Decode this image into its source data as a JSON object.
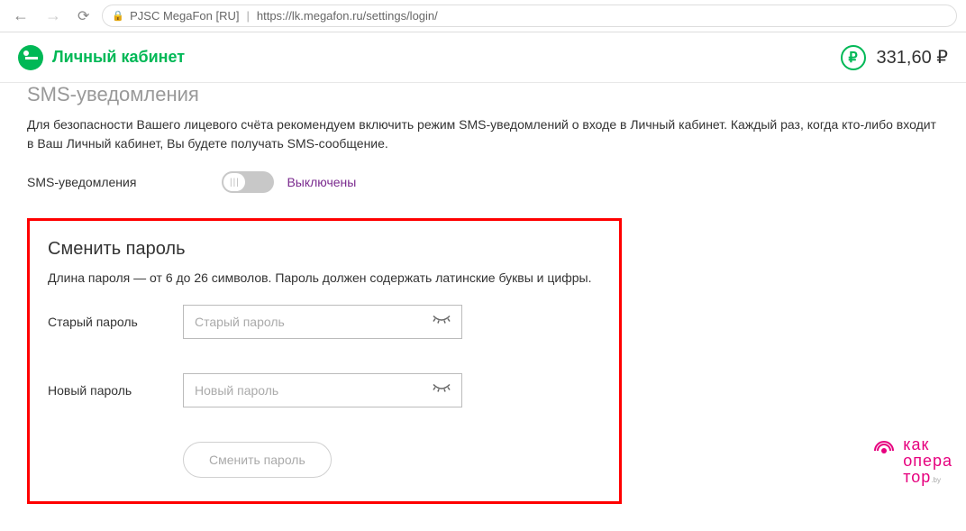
{
  "browser": {
    "site_identity": "PJSC MegaFon [RU]",
    "url": "https://lk.megafon.ru/settings/login/"
  },
  "header": {
    "brand": "Личный кабинет",
    "balance": "331,60 ₽",
    "currency_symbol": "₽"
  },
  "sms": {
    "title": "SMS-уведомления",
    "desc": "Для безопасности Вашего лицевого счёта рекомендуем включить режим SMS-уведомлений о входе в Личный кабинет. Каждый раз, когда кто-либо входит в Ваш Личный кабинет, Вы будете получать SMS-сообщение.",
    "label": "SMS-уведомления",
    "state": "Выключены"
  },
  "change_password": {
    "title": "Сменить пароль",
    "desc": "Длина пароля — от 6 до 26 символов. Пароль должен содержать латинские буквы и цифры.",
    "old_label": "Старый пароль",
    "old_placeholder": "Старый пароль",
    "new_label": "Новый пароль",
    "new_placeholder": "Новый пароль",
    "submit": "Сменить пароль"
  },
  "watermark": {
    "line1": "как",
    "line2": "опера",
    "line3": "тор",
    "sub": ".by"
  }
}
